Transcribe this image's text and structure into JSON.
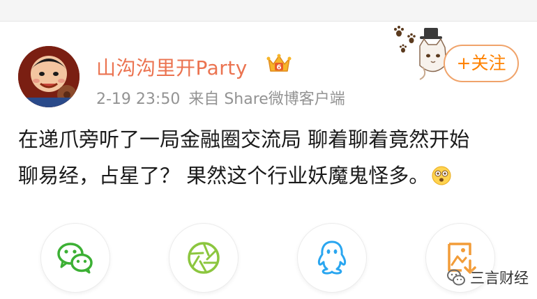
{
  "post": {
    "author": "山沟沟里开Party",
    "vip_level": "6",
    "time": "2-19 23:50",
    "source": "来自 Share微博客户端",
    "text_line1": "在递爪旁听了一局金融圈交流局 聊着聊着竟然开始",
    "text_line2": "聊易经，占星了？ 果然这个行业妖魔鬼怪多。"
  },
  "follow_button": {
    "label": "+关注"
  },
  "share_bar": {
    "items": [
      "wechat-icon",
      "moments-icon",
      "qq-icon",
      "save-image-icon"
    ]
  },
  "watermark": {
    "text": "三言财经"
  },
  "colors": {
    "username": "#eb7350",
    "follow": "#ff8200",
    "meta": "#939393",
    "text": "#1a1a1a",
    "wechat": "#3cb034",
    "moments": "#8cc63f",
    "qq": "#2aa6f0",
    "save": "#f29c38"
  }
}
